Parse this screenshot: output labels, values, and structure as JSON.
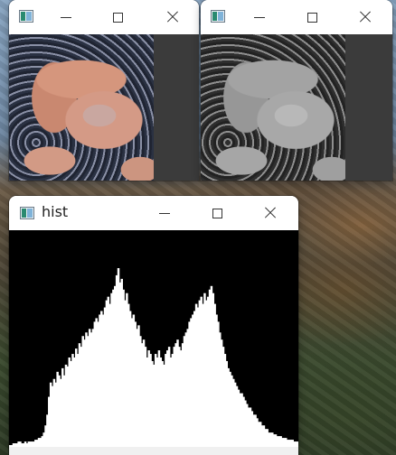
{
  "windows": {
    "color_image": {
      "title": ""
    },
    "gray_image": {
      "title": ""
    },
    "histogram": {
      "title": "hist"
    }
  },
  "icons": {
    "app": "opencv-window-icon",
    "minimize": "minimize-icon",
    "maximize": "maximize-icon",
    "close": "close-icon"
  },
  "colors": {
    "hist_background": "#000000",
    "hist_bars": "#ffffff",
    "image_pane_background": "#3b3b3b"
  },
  "chart_data": {
    "type": "bar",
    "x_range": [
      0,
      255
    ],
    "values": [
      0.01,
      0.01,
      0.02,
      0.02,
      0.02,
      0.03,
      0.03,
      0.02,
      0.02,
      0.03,
      0.02,
      0.03,
      0.03,
      0.03,
      0.03,
      0.04,
      0.04,
      0.05,
      0.05,
      0.06,
      0.08,
      0.12,
      0.18,
      0.28,
      0.36,
      0.34,
      0.38,
      0.36,
      0.42,
      0.4,
      0.38,
      0.44,
      0.4,
      0.46,
      0.45,
      0.5,
      0.48,
      0.52,
      0.5,
      0.55,
      0.52,
      0.58,
      0.56,
      0.62,
      0.6,
      0.64,
      0.62,
      0.66,
      0.64,
      0.66,
      0.7,
      0.72,
      0.7,
      0.74,
      0.76,
      0.74,
      0.78,
      0.82,
      0.84,
      0.8,
      0.86,
      0.88,
      0.9,
      0.96,
      1.0,
      0.92,
      0.94,
      0.88,
      0.82,
      0.86,
      0.8,
      0.76,
      0.72,
      0.74,
      0.7,
      0.66,
      0.68,
      0.62,
      0.58,
      0.6,
      0.56,
      0.5,
      0.54,
      0.52,
      0.48,
      0.46,
      0.52,
      0.5,
      0.54,
      0.5,
      0.48,
      0.46,
      0.52,
      0.54,
      0.56,
      0.5,
      0.52,
      0.56,
      0.58,
      0.6,
      0.56,
      0.54,
      0.58,
      0.62,
      0.64,
      0.66,
      0.7,
      0.72,
      0.74,
      0.76,
      0.8,
      0.78,
      0.82,
      0.84,
      0.8,
      0.86,
      0.82,
      0.84,
      0.88,
      0.9,
      0.86,
      0.8,
      0.74,
      0.7,
      0.64,
      0.6,
      0.56,
      0.52,
      0.48,
      0.44,
      0.42,
      0.4,
      0.38,
      0.36,
      0.34,
      0.32,
      0.3,
      0.3,
      0.28,
      0.26,
      0.24,
      0.22,
      0.22,
      0.2,
      0.18,
      0.18,
      0.16,
      0.14,
      0.14,
      0.12,
      0.12,
      0.1,
      0.1,
      0.08,
      0.08,
      0.08,
      0.07,
      0.07,
      0.06,
      0.06,
      0.06,
      0.05,
      0.05,
      0.05,
      0.04,
      0.04,
      0.04,
      0.04,
      0.03,
      0.03,
      0.03
    ]
  }
}
